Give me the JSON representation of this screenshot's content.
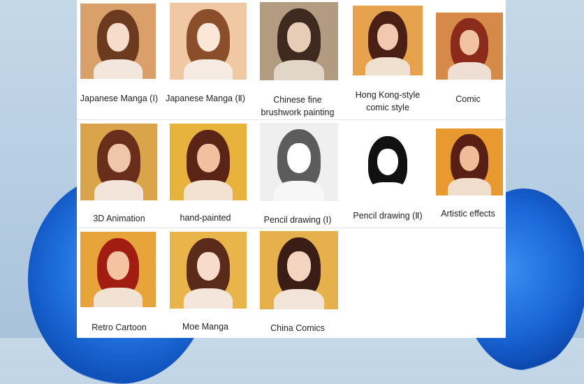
{
  "gallery": {
    "rows": [
      [
        {
          "label": "Japanese Manga (Ⅰ)",
          "bg": "#d9a06a",
          "hair": "#6b3a1f",
          "face": "#f6dccb",
          "shirt": "#f3e6dc",
          "icon": "portrait-japanese-manga-1-icon"
        },
        {
          "label": "Japanese Manga (Ⅱ)",
          "bg": "#f0c9a4",
          "hair": "#8a4e2a",
          "face": "#fbe6d8",
          "shirt": "#f5ebe2",
          "icon": "portrait-japanese-manga-2-icon"
        },
        {
          "label": "Chinese fine brushwork painting",
          "bg": "#b39b82",
          "hair": "#3e2a1e",
          "face": "#e8cdb6",
          "shirt": "#e2d6c9",
          "icon": "portrait-chinese-brushwork-icon"
        },
        {
          "label": "Hong Kong-style comic style",
          "bg": "#e6a24d",
          "hair": "#4a2014",
          "face": "#f2c9ae",
          "shirt": "#f0e0d0",
          "icon": "portrait-hong-kong-comic-icon"
        },
        {
          "label": "Comic",
          "bg": "#d58a4a",
          "hair": "#8b2b1c",
          "face": "#f1c2a4",
          "shirt": "#efdfd2",
          "icon": "portrait-comic-icon"
        }
      ],
      [
        {
          "label": "3D Animation",
          "bg": "#d9a44a",
          "hair": "#6a2f1c",
          "face": "#f0c6a8",
          "shirt": "#f2e4d8",
          "icon": "portrait-3d-animation-icon"
        },
        {
          "label": "hand-painted",
          "bg": "#e8b33c",
          "hair": "#5a2416",
          "face": "#f1c0a0",
          "shirt": "#f3e2d2",
          "icon": "portrait-hand-painted-icon"
        },
        {
          "label": "Pencil drawing (Ⅰ)",
          "bg": "#efefef",
          "hair": "#5c5c5c",
          "face": "#ffffff",
          "shirt": "#f7f7f7",
          "icon": "portrait-pencil-drawing-1-icon"
        },
        {
          "label": "Pencil drawing (Ⅱ)",
          "bg": "#ffffff",
          "hair": "#111111",
          "face": "#ffffff",
          "shirt": "#ffffff",
          "icon": "portrait-pencil-drawing-2-icon"
        },
        {
          "label": "Artistic effects",
          "bg": "#e89a30",
          "hair": "#5a1f14",
          "face": "#f0bc98",
          "shirt": "#f1ddcc",
          "icon": "portrait-artistic-effects-icon"
        }
      ],
      [
        {
          "label": "Retro Cartoon",
          "bg": "#e7a43a",
          "hair": "#a11d12",
          "face": "#f3c3a2",
          "shirt": "#f2e2d4",
          "icon": "portrait-retro-cartoon-icon"
        },
        {
          "label": "Moe Manga",
          "bg": "#e9b44a",
          "hair": "#5a2a1a",
          "face": "#f8dccb",
          "shirt": "#f4e6da",
          "icon": "portrait-moe-manga-icon"
        },
        {
          "label": "China Comics",
          "bg": "#e6b04d",
          "hair": "#3a1d14",
          "face": "#f5d4c0",
          "shirt": "#f2e4d8",
          "icon": "portrait-china-comics-icon"
        }
      ]
    ]
  }
}
